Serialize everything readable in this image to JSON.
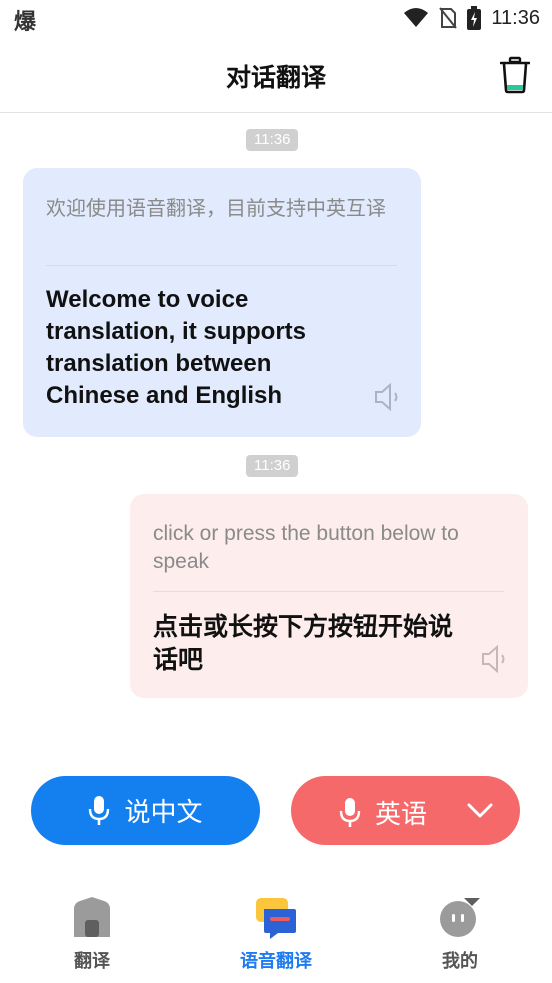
{
  "status_bar": {
    "left_glyph": "爆",
    "time": "11:36"
  },
  "header": {
    "title": "对话翻译"
  },
  "messages": [
    {
      "time": "11:36",
      "side": "left",
      "source_text": "欢迎使用语音翻译，目前支持中英互译",
      "translated_text": "Welcome to voice translation, it supports translation between Chinese and English"
    },
    {
      "time": "11:36",
      "side": "right",
      "source_text": "click or press the button below to speak",
      "translated_text": "点击或长按下方按钮开始说话吧"
    }
  ],
  "buttons": {
    "left_label": "说中文",
    "right_label": "英语"
  },
  "bottom_nav": {
    "items": [
      {
        "label": "翻译"
      },
      {
        "label": "语音翻译"
      },
      {
        "label": "我的"
      }
    ],
    "active_index": 1
  },
  "colors": {
    "accent_blue": "#1480f0",
    "accent_red": "#f5696b",
    "bubble_left_bg": "#e1ebfd",
    "bubble_right_bg": "#fdeeed"
  },
  "icons": {
    "header_action": "trash-icon",
    "bubble_action": "speaker-icon",
    "button_icon": "microphone-icon",
    "dropdown": "chevron-down-icon",
    "nav_home": "home-icon",
    "nav_chat": "chat-translate-icon",
    "nav_profile": "profile-icon"
  }
}
